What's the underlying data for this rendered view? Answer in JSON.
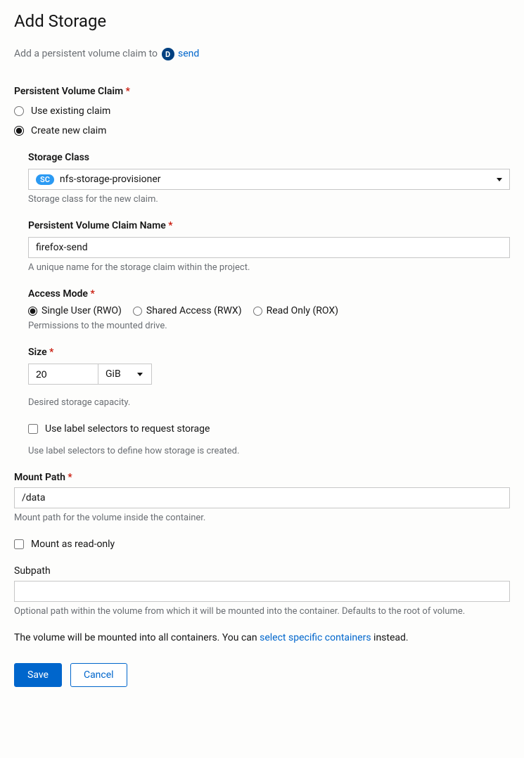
{
  "title": "Add Storage",
  "intro": {
    "prefix": "Add a persistent volume claim to ",
    "badge": "D",
    "link": "send"
  },
  "pvc": {
    "label": "Persistent Volume Claim",
    "existing": "Use existing claim",
    "create": "Create new claim"
  },
  "storageClass": {
    "label": "Storage Class",
    "badge": "SC",
    "value": "nfs-storage-provisioner",
    "hint": "Storage class for the new claim."
  },
  "pvcName": {
    "label": "Persistent Volume Claim Name",
    "value": "firefox-send",
    "hint": "A unique name for the storage claim within the project."
  },
  "accessMode": {
    "label": "Access Mode",
    "single": "Single User (RWO)",
    "shared": "Shared Access (RWX)",
    "readonly": "Read Only (ROX)",
    "hint": "Permissions to the mounted drive."
  },
  "size": {
    "label": "Size",
    "value": "20",
    "unit": "GiB",
    "hint": "Desired storage capacity."
  },
  "labelSelectors": {
    "checkbox": "Use label selectors to request storage",
    "hint": "Use label selectors to define how storage is created."
  },
  "mountPath": {
    "label": "Mount Path",
    "value": "/data",
    "hint": "Mount path for the volume inside the container."
  },
  "mountReadonly": "Mount as read-only",
  "subpath": {
    "label": "Subpath",
    "value": "",
    "hint": "Optional path within the volume from which it will be mounted into the container. Defaults to the root of volume."
  },
  "mountNote": {
    "prefix": "The volume will be mounted into all containers. You can ",
    "link": "select specific containers",
    "suffix": " instead."
  },
  "buttons": {
    "save": "Save",
    "cancel": "Cancel"
  }
}
